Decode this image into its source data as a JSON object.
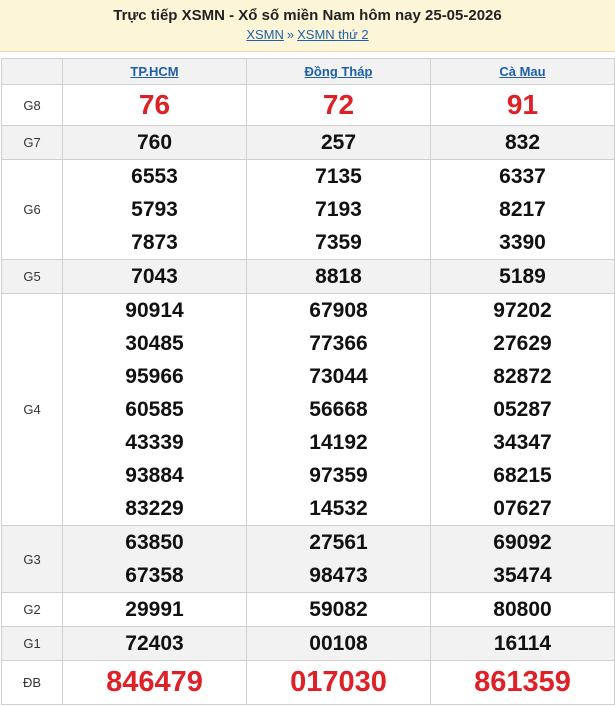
{
  "header": {
    "title": "Trực tiếp XSMN - Xổ số miền Nam hôm nay 25-05-2026",
    "crumb1": "XSMN",
    "separator": "»",
    "crumb2": "XSMN thứ 2"
  },
  "provinces": [
    "TP.HCM",
    "Đồng Tháp",
    "Cà Mau"
  ],
  "prizes": [
    {
      "label": "G8",
      "rows": [
        [
          "76",
          "72",
          "91"
        ]
      ]
    },
    {
      "label": "G7",
      "rows": [
        [
          "760",
          "257",
          "832"
        ]
      ]
    },
    {
      "label": "G6",
      "rows": [
        [
          "6553",
          "7135",
          "6337"
        ],
        [
          "5793",
          "7193",
          "8217"
        ],
        [
          "7873",
          "7359",
          "3390"
        ]
      ]
    },
    {
      "label": "G5",
      "rows": [
        [
          "7043",
          "8818",
          "5189"
        ]
      ]
    },
    {
      "label": "G4",
      "rows": [
        [
          "90914",
          "67908",
          "97202"
        ],
        [
          "30485",
          "77366",
          "27629"
        ],
        [
          "95966",
          "73044",
          "82872"
        ],
        [
          "60585",
          "56668",
          "05287"
        ],
        [
          "43339",
          "14192",
          "34347"
        ],
        [
          "93884",
          "97359",
          "68215"
        ],
        [
          "83229",
          "14532",
          "07627"
        ]
      ]
    },
    {
      "label": "G3",
      "rows": [
        [
          "63850",
          "27561",
          "69092"
        ],
        [
          "67358",
          "98473",
          "35474"
        ]
      ]
    },
    {
      "label": "G2",
      "rows": [
        [
          "29991",
          "59082",
          "80800"
        ]
      ]
    },
    {
      "label": "G1",
      "rows": [
        [
          "72403",
          "00108",
          "16114"
        ]
      ]
    },
    {
      "label": "ĐB",
      "rows": [
        [
          "846479",
          "017030",
          "861359"
        ]
      ]
    }
  ],
  "colors": {
    "highlight": "#e02027",
    "link": "#1e5fa8",
    "header_bg": "#fdf5d8"
  }
}
